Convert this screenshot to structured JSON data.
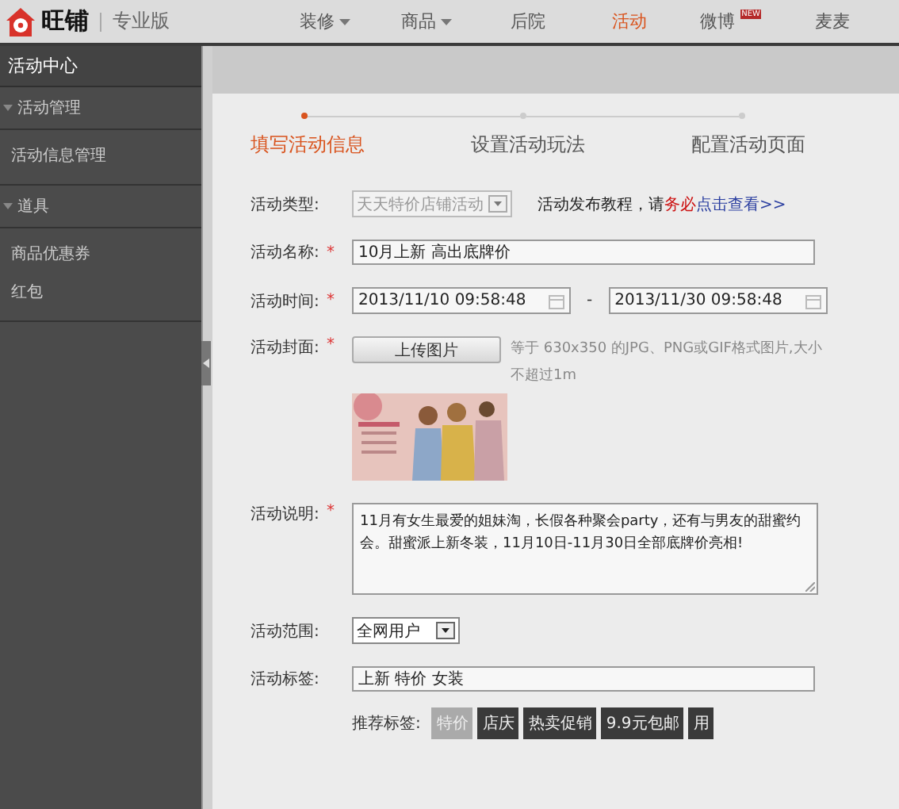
{
  "brand": {
    "name": "旺铺",
    "edition": "专业版"
  },
  "nav": [
    {
      "label": "装修",
      "dropdown": true,
      "selected": false
    },
    {
      "label": "商品",
      "dropdown": true,
      "selected": false
    },
    {
      "label": "后院",
      "dropdown": false,
      "selected": false
    },
    {
      "label": "活动",
      "dropdown": false,
      "selected": true
    },
    {
      "label": "微博",
      "dropdown": false,
      "selected": false,
      "badge": "NEW"
    },
    {
      "label": "麦麦",
      "dropdown": false,
      "selected": false
    }
  ],
  "sidebar": {
    "title": "活动中心",
    "groups": [
      {
        "label": "活动管理",
        "expanded": true,
        "children": [
          {
            "label": "活动信息管理"
          }
        ]
      },
      {
        "label": "道具",
        "expanded": true,
        "children": [
          {
            "label": "商品优惠券"
          },
          {
            "label": "红包"
          }
        ]
      }
    ]
  },
  "steps": [
    {
      "label": "填写活动信息",
      "selected": true
    },
    {
      "label": "设置活动玩法",
      "selected": false
    },
    {
      "label": "配置活动页面",
      "selected": false
    }
  ],
  "form": {
    "type": {
      "label": "活动类型:",
      "value": "天天特价店铺活动",
      "disabled": true,
      "hint_before": "活动发布教程，请",
      "hint_emphasis": "务必",
      "hint_link": "点击查看>>"
    },
    "name": {
      "label": "活动名称:",
      "required_mark": "*",
      "value": "10月上新 高出底牌价"
    },
    "time": {
      "label": "活动时间:",
      "required_mark": "*",
      "start": "2013/11/10 09:58:48",
      "separator": "-",
      "end": "2013/11/30 09:58:48"
    },
    "cover": {
      "label": "活动封面:",
      "required_mark": "*",
      "button": "上传图片",
      "note": "等于 630x350 的JPG、PNG或GIF格式图片,大小不超过1m"
    },
    "description": {
      "label": "活动说明:",
      "required_mark": "*",
      "value": "11月有女生最爱的姐妹淘，长假各种聚会party，还有与男友的甜蜜约会。甜蜜派上新冬装，11月10日-11月30日全部底牌价亮相!"
    },
    "scope": {
      "label": "活动范围:",
      "value": "全网用户"
    },
    "tags": {
      "label": "活动标签:",
      "value": "上新 特价 女装",
      "recommended_label": "推荐标签:",
      "recommended": [
        {
          "label": "特价",
          "selected": true
        },
        {
          "label": "店庆",
          "selected": false
        },
        {
          "label": "热卖促销",
          "selected": false
        },
        {
          "label": "9.9元包邮",
          "selected": false
        },
        {
          "label": "用",
          "selected": false
        }
      ]
    }
  }
}
